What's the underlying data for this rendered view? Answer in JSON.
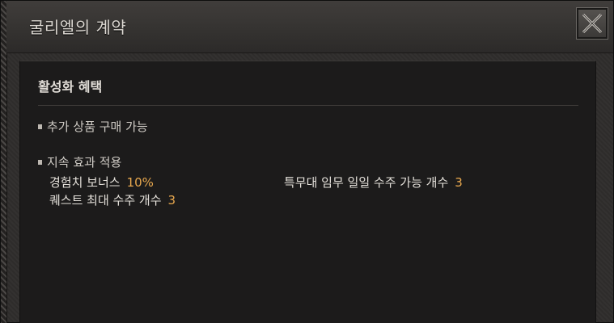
{
  "window": {
    "title": "굴리엘의 계약"
  },
  "icons": {
    "close": "close-x-icon",
    "bullet": "square-bullet-icon"
  },
  "colors": {
    "accent_value": "#e8a84e",
    "panel_bg": "#1c1b1b",
    "window_bg": "#2f2d2c"
  },
  "panel": {
    "heading": "활성화 혜택",
    "bullets": [
      {
        "label": "추가 상품 구매 가능"
      },
      {
        "label": "지속 효과 적용"
      }
    ],
    "effects": [
      {
        "label": "경험치 보너스",
        "value": "10%"
      },
      {
        "label": "특무대 임무 일일 수주 가능 개수",
        "value": "3"
      },
      {
        "label": "퀘스트 최대 수주 개수",
        "value": "3"
      }
    ]
  }
}
